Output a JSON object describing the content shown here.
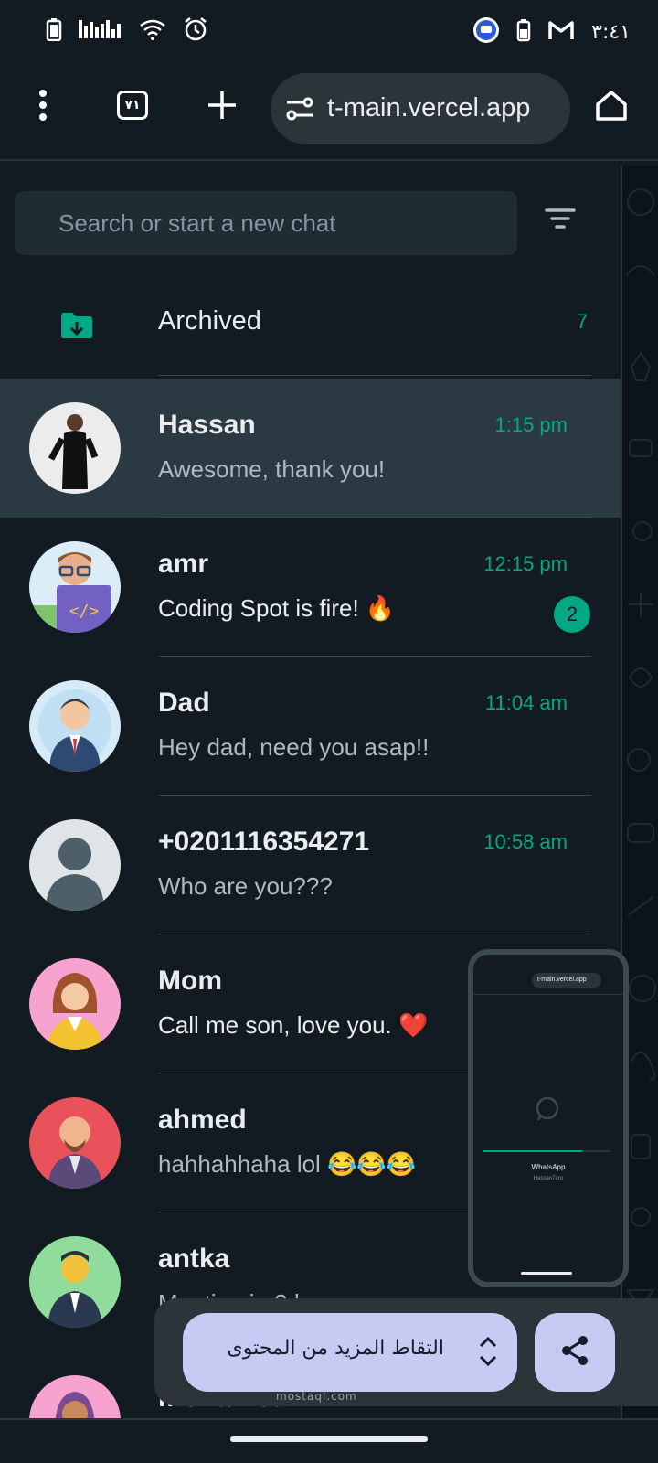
{
  "status_bar": {
    "time": "٣:٤١",
    "icons": [
      "battery-icon",
      "signal-bars-icon",
      "wifi-icon",
      "alarm-icon",
      "app-badge-icon",
      "battery-small-icon",
      "gmail-icon"
    ]
  },
  "browser": {
    "url": "t-main.vercel.app",
    "tab_count": "٧١",
    "icons": [
      "more-vert-icon",
      "tab-switcher-icon",
      "new-tab-icon",
      "site-settings-icon",
      "home-icon"
    ]
  },
  "search": {
    "placeholder": "Search or start a new chat"
  },
  "archived": {
    "label": "Archived",
    "count": "7"
  },
  "chats": [
    {
      "name": "Hassan",
      "time": "1:15 pm",
      "message": "Awesome, thank you!",
      "active": true
    },
    {
      "name": "amr",
      "time": "12:15 pm",
      "message": "Coding Spot is fire! 🔥",
      "unread": "2"
    },
    {
      "name": "Dad",
      "time": "11:04 am",
      "message": "Hey dad, need you asap!!"
    },
    {
      "name": "+0201116354271",
      "time": "10:58 am",
      "message": "Who are you???"
    },
    {
      "name": "Mom",
      "message": "Call me son, love you. ❤️"
    },
    {
      "name": "ahmed",
      "message": "hahhahhaha lol 😂😂😂"
    },
    {
      "name": "antka",
      "message": "Meeting in 3 ho"
    },
    {
      "name": "mohamed"
    }
  ],
  "preview": {
    "url": "t-main.vercel.app",
    "title": "WhatsApp",
    "subtitle": "Hassan7ero",
    "progress": 0.78
  },
  "capture": {
    "label": "التقاط المزيد من المحتوى"
  },
  "watermark": "mostaql.com",
  "colors": {
    "background": "#111b21",
    "accent": "#00a884",
    "capture_button": "#c6cbf3"
  }
}
